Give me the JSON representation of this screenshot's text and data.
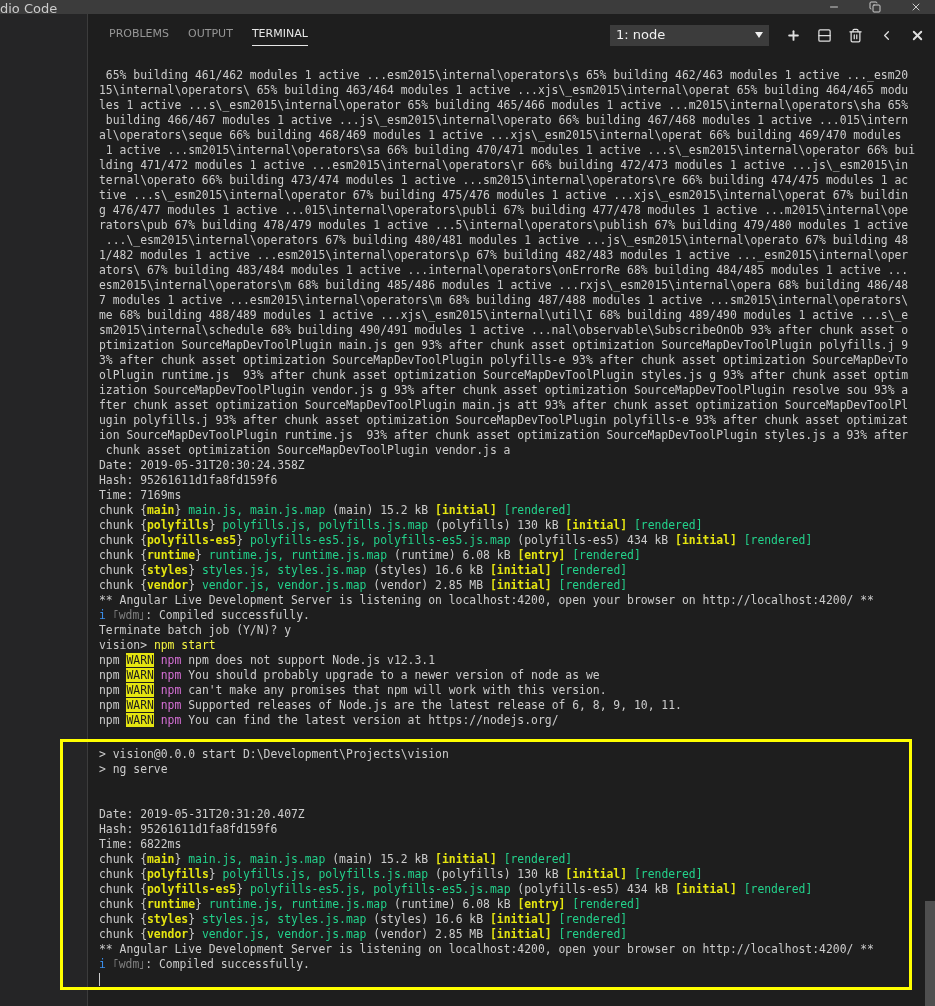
{
  "window": {
    "title": "dio Code"
  },
  "panel": {
    "tabs": [
      {
        "label": "PROBLEMS",
        "selected": false
      },
      {
        "label": "OUTPUT",
        "selected": false
      },
      {
        "label": "TERMINAL",
        "selected": true
      }
    ],
    "terminal_selector": {
      "value": "1: node"
    },
    "terminal": {
      "lines": [
        {
          "kind": "plain",
          "text": " 65% building 461/462 modules 1 active ...esm2015\\internal\\operators\\s 65% building 462/463 modules 1 active ..._esm20"
        },
        {
          "kind": "plain",
          "text": "15\\internal\\operators\\ 65% building 463/464 modules 1 active ...xjs\\_esm2015\\internal\\operat 65% building 464/465 modu"
        },
        {
          "kind": "plain",
          "text": "les 1 active ...s\\_esm2015\\internal\\operator 65% building 465/466 modules 1 active ...m2015\\internal\\operators\\sha 65%"
        },
        {
          "kind": "plain",
          "text": " building 466/467 modules 1 active ...js\\_esm2015\\internal\\operato 66% building 467/468 modules 1 active ...015\\intern"
        },
        {
          "kind": "plain",
          "text": "al\\operators\\seque 66% building 468/469 modules 1 active ...xjs\\_esm2015\\internal\\operat 66% building 469/470 modules"
        },
        {
          "kind": "plain",
          "text": " 1 active ...sm2015\\internal\\operators\\sa 66% building 470/471 modules 1 active ...s\\_esm2015\\internal\\operator 66% bui"
        },
        {
          "kind": "plain",
          "text": "lding 471/472 modules 1 active ...esm2015\\internal\\operators\\r 66% building 472/473 modules 1 active ...js\\_esm2015\\in"
        },
        {
          "kind": "plain",
          "text": "ternal\\operato 66% building 473/474 modules 1 active ...sm2015\\internal\\operators\\re 66% building 474/475 modules 1 ac"
        },
        {
          "kind": "plain",
          "text": "tive ...s\\_esm2015\\internal\\operator 67% building 475/476 modules 1 active ...xjs\\_esm2015\\internal\\operat 67% buildin"
        },
        {
          "kind": "plain",
          "text": "g 476/477 modules 1 active ...015\\internal\\operators\\publi 67% building 477/478 modules 1 active ...m2015\\internal\\ope"
        },
        {
          "kind": "plain",
          "text": "rators\\pub 67% building 478/479 modules 1 active ...5\\internal\\operators\\publish 67% building 479/480 modules 1 active"
        },
        {
          "kind": "plain",
          "text": " ...\\_esm2015\\internal\\operators 67% building 480/481 modules 1 active ...js\\_esm2015\\internal\\operato 67% building 48"
        },
        {
          "kind": "plain",
          "text": "1/482 modules 1 active ...esm2015\\internal\\operators\\p 67% building 482/483 modules 1 active ..._esm2015\\internal\\oper"
        },
        {
          "kind": "plain",
          "text": "ators\\ 67% building 483/484 modules 1 active ...internal\\operators\\onErrorRe 68% building 484/485 modules 1 active ..."
        },
        {
          "kind": "plain",
          "text": "esm2015\\internal\\operators\\m 68% building 485/486 modules 1 active ...rxjs\\_esm2015\\internal\\opera 68% building 486/48"
        },
        {
          "kind": "plain",
          "text": "7 modules 1 active ...esm2015\\internal\\operators\\m 68% building 487/488 modules 1 active ...sm2015\\internal\\operators\\"
        },
        {
          "kind": "plain",
          "text": "me 68% building 488/489 modules 1 active ...xjs\\_esm2015\\internal\\util\\I 68% building 489/490 modules 1 active ...s\\_e"
        },
        {
          "kind": "plain",
          "text": "sm2015\\internal\\schedule 68% building 490/491 modules 1 active ...nal\\observable\\SubscribeOnOb 93% after chunk asset o"
        },
        {
          "kind": "plain",
          "text": "ptimization SourceMapDevToolPlugin main.js gen 93% after chunk asset optimization SourceMapDevToolPlugin polyfills.j 9"
        },
        {
          "kind": "plain",
          "text": "3% after chunk asset optimization SourceMapDevToolPlugin polyfills-e 93% after chunk asset optimization SourceMapDevTo"
        },
        {
          "kind": "plain",
          "text": "olPlugin runtime.js  93% after chunk asset optimization SourceMapDevToolPlugin styles.js g 93% after chunk asset optim"
        },
        {
          "kind": "plain",
          "text": "ization SourceMapDevToolPlugin vendor.js g 93% after chunk asset optimization SourceMapDevToolPlugin resolve sou 93% a"
        },
        {
          "kind": "plain",
          "text": "fter chunk asset optimization SourceMapDevToolPlugin main.js att 93% after chunk asset optimization SourceMapDevToolPl"
        },
        {
          "kind": "plain",
          "text": "ugin polyfills.j 93% after chunk asset optimization SourceMapDevToolPlugin polyfills-e 93% after chunk asset optimizat"
        },
        {
          "kind": "plain",
          "text": "ion SourceMapDevToolPlugin runtime.js  93% after chunk asset optimization SourceMapDevToolPlugin styles.js a 93% after"
        },
        {
          "kind": "plain",
          "text": " chunk asset optimization SourceMapDevToolPlugin vendor.js a"
        },
        {
          "kind": "plain",
          "text": "Date: 2019-05-31T20:30:24.358Z"
        },
        {
          "kind": "plain",
          "text": "Hash: 95261611d1fa8fd159f6"
        },
        {
          "kind": "plain",
          "text": "Time: 7169ms"
        },
        {
          "kind": "styled",
          "spans": [
            {
              "kind": "plain",
              "text": "chunk {"
            },
            {
              "kind": "name",
              "text": "main"
            },
            {
              "kind": "plain",
              "text": "} "
            },
            {
              "kind": "file",
              "text": "main.js, main.js.map"
            },
            {
              "kind": "plain",
              "text": " (main) 15.2 kB "
            },
            {
              "kind": "name",
              "text": "[initial]"
            },
            {
              "kind": "file",
              "text": " [rendered]"
            }
          ]
        },
        {
          "kind": "styled",
          "spans": [
            {
              "kind": "plain",
              "text": "chunk {"
            },
            {
              "kind": "name",
              "text": "polyfills"
            },
            {
              "kind": "plain",
              "text": "} "
            },
            {
              "kind": "file",
              "text": "polyfills.js, polyfills.js.map"
            },
            {
              "kind": "plain",
              "text": " (polyfills) 130 kB "
            },
            {
              "kind": "name",
              "text": "[initial]"
            },
            {
              "kind": "file",
              "text": " [rendered]"
            }
          ]
        },
        {
          "kind": "styled",
          "spans": [
            {
              "kind": "plain",
              "text": "chunk {"
            },
            {
              "kind": "name",
              "text": "polyfills-es5"
            },
            {
              "kind": "plain",
              "text": "} "
            },
            {
              "kind": "file",
              "text": "polyfills-es5.js, polyfills-es5.js.map"
            },
            {
              "kind": "plain",
              "text": " (polyfills-es5) 434 kB "
            },
            {
              "kind": "name",
              "text": "[initial]"
            },
            {
              "kind": "file",
              "text": " [rendered]"
            }
          ]
        },
        {
          "kind": "styled",
          "spans": [
            {
              "kind": "plain",
              "text": "chunk {"
            },
            {
              "kind": "name",
              "text": "runtime"
            },
            {
              "kind": "plain",
              "text": "} "
            },
            {
              "kind": "file",
              "text": "runtime.js, runtime.js.map"
            },
            {
              "kind": "plain",
              "text": " (runtime) 6.08 kB "
            },
            {
              "kind": "name",
              "text": "[entry]"
            },
            {
              "kind": "file",
              "text": " [rendered]"
            }
          ]
        },
        {
          "kind": "styled",
          "spans": [
            {
              "kind": "plain",
              "text": "chunk {"
            },
            {
              "kind": "name",
              "text": "styles"
            },
            {
              "kind": "plain",
              "text": "} "
            },
            {
              "kind": "file",
              "text": "styles.js, styles.js.map"
            },
            {
              "kind": "plain",
              "text": " (styles) 16.6 kB "
            },
            {
              "kind": "name",
              "text": "[initial]"
            },
            {
              "kind": "file",
              "text": " [rendered]"
            }
          ]
        },
        {
          "kind": "styled",
          "spans": [
            {
              "kind": "plain",
              "text": "chunk {"
            },
            {
              "kind": "name",
              "text": "vendor"
            },
            {
              "kind": "plain",
              "text": "} "
            },
            {
              "kind": "file",
              "text": "vendor.js, vendor.js.map"
            },
            {
              "kind": "plain",
              "text": " (vendor) 2.85 MB "
            },
            {
              "kind": "name",
              "text": "[initial]"
            },
            {
              "kind": "file",
              "text": " [rendered]"
            }
          ]
        },
        {
          "kind": "plain",
          "text": "** Angular Live Development Server is listening on localhost:4200, open your browser on http://localhost:4200/ **"
        },
        {
          "kind": "styled",
          "spans": [
            {
              "kind": "info",
              "text": "i"
            },
            {
              "kind": "dim",
              "text": " ｢wdm｣"
            },
            {
              "kind": "plain",
              "text": ": Compiled successfully."
            }
          ]
        },
        {
          "kind": "plain",
          "text": "Terminate batch job (Y/N)? y"
        },
        {
          "kind": "styled",
          "spans": [
            {
              "kind": "plain",
              "text": "vision> "
            },
            {
              "kind": "command",
              "text": "npm start"
            }
          ]
        },
        {
          "kind": "styled",
          "spans": [
            {
              "kind": "plain",
              "text": "npm "
            },
            {
              "kind": "warn",
              "text": "WARN"
            },
            {
              "kind": "npm",
              "text": " npm"
            },
            {
              "kind": "plain",
              "text": " npm does not support Node.js v12.3.1"
            }
          ]
        },
        {
          "kind": "styled",
          "spans": [
            {
              "kind": "plain",
              "text": "npm "
            },
            {
              "kind": "warn",
              "text": "WARN"
            },
            {
              "kind": "npm",
              "text": " npm"
            },
            {
              "kind": "plain",
              "text": " You should probably upgrade to a newer version of node as we"
            }
          ]
        },
        {
          "kind": "styled",
          "spans": [
            {
              "kind": "plain",
              "text": "npm "
            },
            {
              "kind": "warn",
              "text": "WARN"
            },
            {
              "kind": "npm",
              "text": " npm"
            },
            {
              "kind": "plain",
              "text": " can't make any promises that npm will work with this version."
            }
          ]
        },
        {
          "kind": "styled",
          "spans": [
            {
              "kind": "plain",
              "text": "npm "
            },
            {
              "kind": "warn",
              "text": "WARN"
            },
            {
              "kind": "npm",
              "text": " npm"
            },
            {
              "kind": "plain",
              "text": " Supported releases of Node.js are the latest release of 6, 8, 9, 10, 11."
            }
          ]
        },
        {
          "kind": "styled",
          "spans": [
            {
              "kind": "plain",
              "text": "npm "
            },
            {
              "kind": "warn",
              "text": "WARN"
            },
            {
              "kind": "npm",
              "text": " npm"
            },
            {
              "kind": "plain",
              "text": " You can find the latest version at https://nodejs.org/"
            }
          ]
        }
      ],
      "highlighted_block": {
        "lines": [
          {
            "kind": "plain",
            "text": "> vision@0.0.0 start D:\\Development\\Projects\\vision"
          },
          {
            "kind": "plain",
            "text": "> ng serve"
          },
          {
            "kind": "blank"
          },
          {
            "kind": "blank"
          },
          {
            "kind": "plain",
            "text": "Date: 2019-05-31T20:31:20.407Z"
          },
          {
            "kind": "plain",
            "text": "Hash: 95261611d1fa8fd159f6"
          },
          {
            "kind": "plain",
            "text": "Time: 6822ms"
          },
          {
            "kind": "styled",
            "spans": [
              {
                "kind": "plain",
                "text": "chunk {"
              },
              {
                "kind": "name",
                "text": "main"
              },
              {
                "kind": "plain",
                "text": "} "
              },
              {
                "kind": "file",
                "text": "main.js, main.js.map"
              },
              {
                "kind": "plain",
                "text": " (main) 15.2 kB "
              },
              {
                "kind": "name",
                "text": "[initial]"
              },
              {
                "kind": "file",
                "text": " [rendered]"
              }
            ]
          },
          {
            "kind": "styled",
            "spans": [
              {
                "kind": "plain",
                "text": "chunk {"
              },
              {
                "kind": "name",
                "text": "polyfills"
              },
              {
                "kind": "plain",
                "text": "} "
              },
              {
                "kind": "file",
                "text": "polyfills.js, polyfills.js.map"
              },
              {
                "kind": "plain",
                "text": " (polyfills) 130 kB "
              },
              {
                "kind": "name",
                "text": "[initial]"
              },
              {
                "kind": "file",
                "text": " [rendered]"
              }
            ]
          },
          {
            "kind": "styled",
            "spans": [
              {
                "kind": "plain",
                "text": "chunk {"
              },
              {
                "kind": "name",
                "text": "polyfills-es5"
              },
              {
                "kind": "plain",
                "text": "} "
              },
              {
                "kind": "file",
                "text": "polyfills-es5.js, polyfills-es5.js.map"
              },
              {
                "kind": "plain",
                "text": " (polyfills-es5) 434 kB "
              },
              {
                "kind": "name",
                "text": "[initial]"
              },
              {
                "kind": "file",
                "text": " [rendered]"
              }
            ]
          },
          {
            "kind": "styled",
            "spans": [
              {
                "kind": "plain",
                "text": "chunk {"
              },
              {
                "kind": "name",
                "text": "runtime"
              },
              {
                "kind": "plain",
                "text": "} "
              },
              {
                "kind": "file",
                "text": "runtime.js, runtime.js.map"
              },
              {
                "kind": "plain",
                "text": " (runtime) 6.08 kB "
              },
              {
                "kind": "name",
                "text": "[entry]"
              },
              {
                "kind": "file",
                "text": " [rendered]"
              }
            ]
          },
          {
            "kind": "styled",
            "spans": [
              {
                "kind": "plain",
                "text": "chunk {"
              },
              {
                "kind": "name",
                "text": "styles"
              },
              {
                "kind": "plain",
                "text": "} "
              },
              {
                "kind": "file",
                "text": "styles.js, styles.js.map"
              },
              {
                "kind": "plain",
                "text": " (styles) 16.6 kB "
              },
              {
                "kind": "name",
                "text": "[initial]"
              },
              {
                "kind": "file",
                "text": " [rendered]"
              }
            ]
          },
          {
            "kind": "styled",
            "spans": [
              {
                "kind": "plain",
                "text": "chunk {"
              },
              {
                "kind": "name",
                "text": "vendor"
              },
              {
                "kind": "plain",
                "text": "} "
              },
              {
                "kind": "file",
                "text": "vendor.js, vendor.js.map"
              },
              {
                "kind": "plain",
                "text": " (vendor) 2.85 MB "
              },
              {
                "kind": "name",
                "text": "[initial]"
              },
              {
                "kind": "file",
                "text": " [rendered]"
              }
            ]
          },
          {
            "kind": "plain",
            "text": "** Angular Live Development Server is listening on localhost:4200, open your browser on http://localhost:4200/ **"
          },
          {
            "kind": "styled",
            "spans": [
              {
                "kind": "info",
                "text": "i"
              },
              {
                "kind": "dim",
                "text": " ｢wdm｣"
              },
              {
                "kind": "plain",
                "text": ": Compiled successfully."
              }
            ]
          },
          {
            "kind": "cursor"
          }
        ]
      }
    }
  }
}
